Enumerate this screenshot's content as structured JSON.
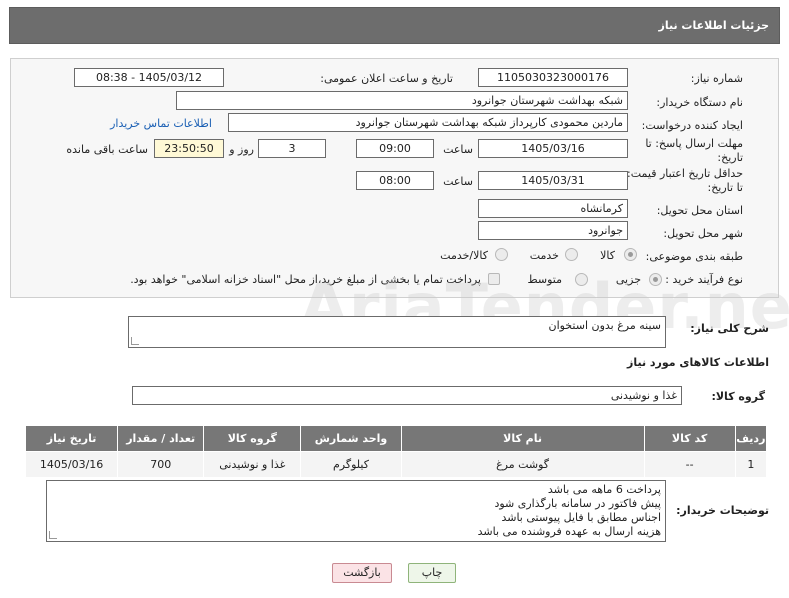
{
  "header": {
    "title": "جزئیات اطلاعات نیاز"
  },
  "form": {
    "need_number_label": "شماره نیاز:",
    "need_number": "1105030323000176",
    "announce_label": "تاریخ و ساعت اعلان عمومی:",
    "announce_value": "1405/03/12 - 08:38",
    "buyer_org_label": "نام دستگاه خریدار:",
    "buyer_org": "شبکه بهداشت شهرستان جوانرود",
    "creator_label": "ایجاد کننده درخواست:",
    "creator": "ماردین محمودی کارپرداز شبکه بهداشت شهرستان جوانرود",
    "contact_link": "اطلاعات تماس خریدار",
    "deadline_label": "مهلت ارسال پاسخ: تا تاریخ:",
    "deadline_date": "1405/03/16",
    "time_label": "ساعت",
    "deadline_time": "09:00",
    "days_value": "3",
    "days_label": "روز و",
    "remaining_value": "23:50:50",
    "remaining_label": "ساعت باقی مانده",
    "validity_label": "حداقل تاریخ اعتبار قیمت: تا تاریخ:",
    "validity_date": "1405/03/31",
    "validity_time": "08:00",
    "province_label": "استان محل تحویل:",
    "province": "کرمانشاه",
    "city_label": "شهر محل تحویل:",
    "city": "جوانرود",
    "category_label": "طبقه بندی موضوعی:",
    "category_options": [
      "کالا",
      "خدمت",
      "کالا/خدمت"
    ],
    "purchase_type_label": "نوع فرآیند خرید :",
    "purchase_options": [
      "جزیی",
      "متوسط"
    ],
    "payment_note": "پرداخت تمام یا بخشی از مبلغ خرید،از محل \"اسناد خزانه اسلامی\" خواهد بود."
  },
  "summary": {
    "label": "شرح کلی نیاز:",
    "value": "سینه مرغ بدون استخوان"
  },
  "goods": {
    "section_title": "اطلاعات کالاهای مورد نیاز",
    "group_label": "گروه کالا:",
    "group_value": "غذا و نوشیدنی",
    "columns": [
      "ردیف",
      "کد کالا",
      "نام کالا",
      "واحد شمارش",
      "گروه کالا",
      "تعداد / مقدار",
      "تاریخ نیاز"
    ],
    "rows": [
      [
        "1",
        "--",
        "گوشت مرغ",
        "کیلوگرم",
        "غذا و نوشیدنی",
        "700",
        "1405/03/16"
      ]
    ]
  },
  "notes": {
    "label": "توضیحات خریدار:",
    "lines": [
      "پرداخت 6 ماهه می باشد",
      "پیش فاکتور در سامانه بارگذاری شود",
      "اجناس مطابق با فایل پیوستی باشد",
      "هزینه ارسال به عهده فروشنده می باشد"
    ]
  },
  "buttons": {
    "print": "چاپ",
    "back": "بازگشت"
  },
  "watermark": "AriaTender.net"
}
